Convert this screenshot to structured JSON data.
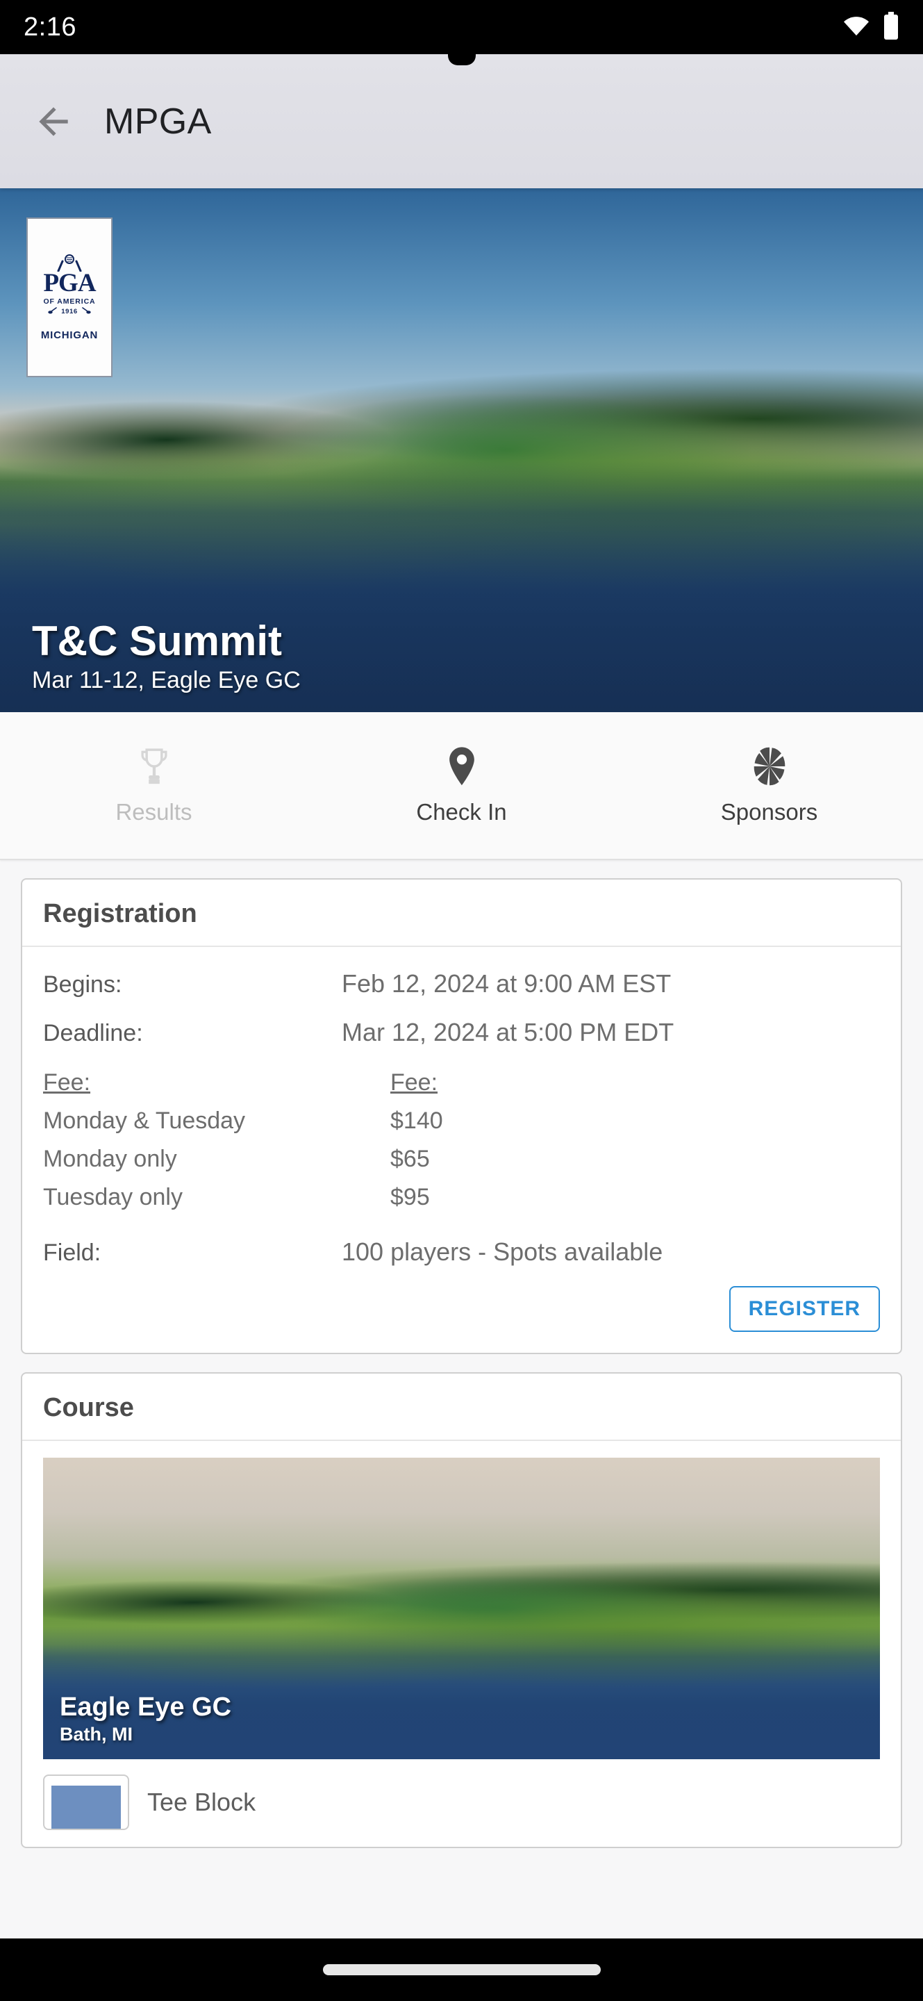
{
  "status_bar": {
    "time": "2:16",
    "wifi_icon": "wifi-icon",
    "battery_icon": "battery-icon"
  },
  "app_bar": {
    "back_icon": "arrow-left-icon",
    "title": "MPGA"
  },
  "hero": {
    "logo": {
      "name": "pga-michigan-logo",
      "word": "PGA",
      "subtitle": "OF AMERICA",
      "year": "1916",
      "state": "MICHIGAN"
    },
    "title": "T&C Summit",
    "subtitle": "Mar 11-12, Eagle Eye GC",
    "image_alt": "golf-course-hero-photo"
  },
  "action_bar": {
    "items": [
      {
        "label": "Results",
        "icon": "trophy-icon",
        "disabled": true
      },
      {
        "label": "Check In",
        "icon": "map-pin-icon",
        "disabled": false
      },
      {
        "label": "Sponsors",
        "icon": "aperture-icon",
        "disabled": false
      }
    ]
  },
  "registration_card": {
    "title": "Registration",
    "begins_label": "Begins:",
    "begins_value": "Feb 12, 2024 at 9:00 AM EST",
    "deadline_label": "Deadline:",
    "deadline_value": "Mar 12, 2024 at 5:00 PM EDT",
    "fee_label_left": "Fee:",
    "fee_label_right": "Fee:",
    "fee_options": [
      {
        "name": "Monday & Tuesday",
        "price": "$140"
      },
      {
        "name": "Monday only",
        "price": "$65"
      },
      {
        "name": "Tuesday only",
        "price": "$95"
      }
    ],
    "field_label": "Field:",
    "field_value": "100 players - Spots available",
    "register_button": "REGISTER",
    "accent_color": "#2b8ed6"
  },
  "course_card": {
    "title": "Course",
    "course_name": "Eagle Eye GC",
    "course_city": "Bath, MI",
    "image_alt": "eagle-eye-gc-photo",
    "tee_label": "Tee Block",
    "tee_swatch_color": "#6d8fc0"
  }
}
